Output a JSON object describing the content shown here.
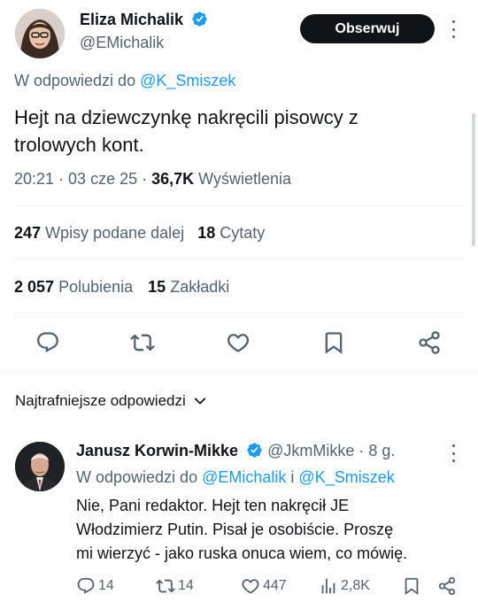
{
  "author": {
    "name": "Eliza Michalik",
    "handle": "@EMichalik",
    "follow_label": "Obserwuj"
  },
  "tweet": {
    "reply_prefix": "W odpowiedzi do",
    "reply_handle": "@K_Smiszek",
    "text_line1": "Hejt na dziewczynkę nakręcili pisowcy z",
    "text_line2": "trolowych kont.",
    "time": "20:21 · 03 cze 25 · ",
    "views_count": "36,7K",
    "views_label": "Wyświetlenia",
    "reposts_count": "247",
    "reposts_label": "Wpisy podane dalej",
    "quotes_count": "18",
    "quotes_label": "Cytaty",
    "likes_count": "2 057",
    "likes_label": "Polubienia",
    "bookmarks_count": "15",
    "bookmarks_label": "Zakładki"
  },
  "replies_header": "Najtrafniejsze odpowiedzi",
  "reply": {
    "name": "Janusz Korwin-Mikke",
    "handle": "@JkmMikke",
    "time": "· 8 g.",
    "reply_prefix": "W odpowiedzi do",
    "reply_handle1": "@EMichalik",
    "reply_and": "i",
    "reply_handle2": "@K_Smiszek",
    "text_line1": "Nie, Pani redaktor. Hejt ten nakręcił JE",
    "text_line2": "Włodzimierz Putin. Pisał je osobiście. Proszę",
    "text_line3": "mi wierzyć - jako ruska onuca wiem, co mówię.",
    "replies": "14",
    "reposts": "14",
    "likes": "447",
    "views": "2,8K"
  },
  "colors": {
    "accent": "#1d9bf0",
    "text": "#0f1419",
    "muted": "#536471",
    "divider": "#eff3f4"
  }
}
